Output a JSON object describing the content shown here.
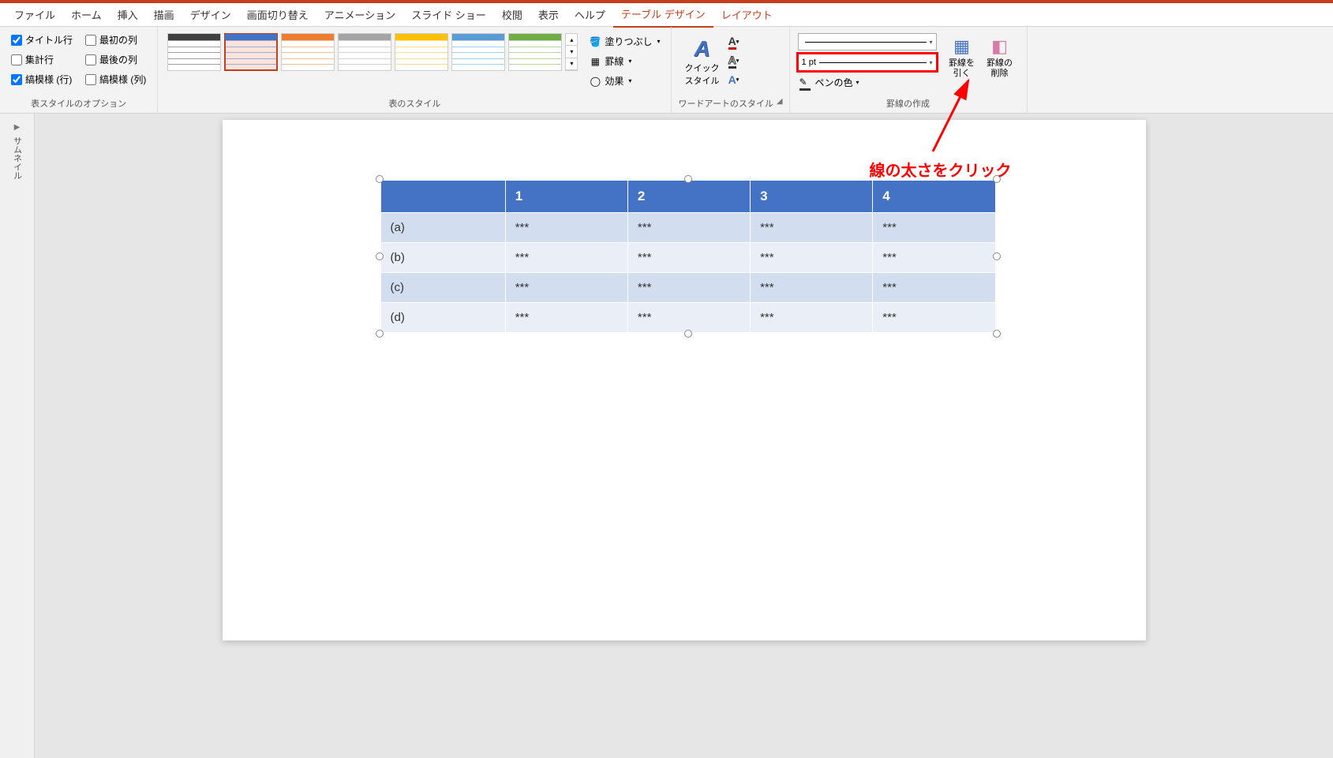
{
  "tabs": {
    "file": "ファイル",
    "home": "ホーム",
    "insert": "挿入",
    "draw": "描画",
    "design": "デザイン",
    "transitions": "画面切り替え",
    "animations": "アニメーション",
    "slideshow": "スライド ショー",
    "review": "校閲",
    "view": "表示",
    "help": "ヘルプ",
    "table_design": "テーブル デザイン",
    "layout": "レイアウト"
  },
  "groups": {
    "style_options": "表スタイルのオプション",
    "table_styles": "表のスタイル",
    "wordart_styles": "ワードアートのスタイル",
    "draw_borders": "罫線の作成"
  },
  "checkboxes": {
    "header_row": "タイトル行",
    "total_row": "集計行",
    "banded_rows": "縞模様 (行)",
    "first_col": "最初の列",
    "last_col": "最後の列",
    "banded_cols": "縞模様 (列)"
  },
  "checkbox_state": {
    "header_row": true,
    "total_row": false,
    "banded_rows": true,
    "first_col": false,
    "last_col": false,
    "banded_cols": false
  },
  "style_colors": [
    "#404040",
    "#4472c4",
    "#ed7d31",
    "#a5a5a5",
    "#ffc000",
    "#5b9bd5",
    "#70ad47"
  ],
  "shading": {
    "fill": "塗りつぶし",
    "borders": "罫線",
    "effects": "効果"
  },
  "wordart": {
    "quick_styles": "クイック\nスタイル"
  },
  "border": {
    "pen_weight": "1 pt",
    "pen_color": "ペンの色"
  },
  "draw": {
    "draw_table": "罫線を\n引く",
    "eraser": "罫線の\n削除"
  },
  "thumbnails": {
    "label": "サムネイル",
    "toggle": "▶"
  },
  "table": {
    "headers": [
      "",
      "1",
      "2",
      "3",
      "4"
    ],
    "rows": [
      [
        "(a)",
        "***",
        "***",
        "***",
        "***"
      ],
      [
        "(b)",
        "***",
        "***",
        "***",
        "***"
      ],
      [
        "(c)",
        "***",
        "***",
        "***",
        "***"
      ],
      [
        "(d)",
        "***",
        "***",
        "***",
        "***"
      ]
    ]
  },
  "annotation": {
    "text": "線の太さをクリック"
  }
}
